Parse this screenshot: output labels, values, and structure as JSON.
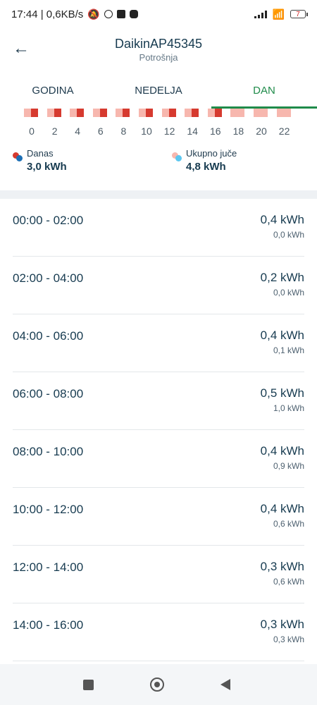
{
  "status": {
    "time_speed": "17:44 | 0,6KB/s",
    "battery": "7"
  },
  "header": {
    "title": "DaikinAP45345",
    "subtitle": "Potrošnja"
  },
  "tabs": [
    {
      "label": "GODINA",
      "active": false
    },
    {
      "label": "NEDELJA",
      "active": false
    },
    {
      "label": "DAN",
      "active": true
    }
  ],
  "chart": {
    "hours": [
      "0",
      "2",
      "4",
      "6",
      "8",
      "10",
      "12",
      "14",
      "16",
      "18",
      "20",
      "22"
    ],
    "today_present": [
      true,
      true,
      true,
      true,
      true,
      true,
      true,
      true,
      true,
      false,
      false,
      false
    ],
    "legend": {
      "today_label": "Danas",
      "today_value": "3,0 kWh",
      "yesterday_label": "Ukupno juče",
      "yesterday_value": "4,8 kWh"
    },
    "colors": {
      "today": "#d63a2f",
      "yesterday": "#f7b7ae",
      "today_dot2": "#1c6fb5",
      "yesterday_dot2": "#5bc7f0"
    }
  },
  "rows": [
    {
      "time": "00:00 - 02:00",
      "value": "0,4 kWh",
      "previous": "0,0 kWh"
    },
    {
      "time": "02:00 - 04:00",
      "value": "0,2 kWh",
      "previous": "0,0 kWh"
    },
    {
      "time": "04:00 - 06:00",
      "value": "0,4 kWh",
      "previous": "0,1 kWh"
    },
    {
      "time": "06:00 - 08:00",
      "value": "0,5 kWh",
      "previous": "1,0 kWh"
    },
    {
      "time": "08:00 - 10:00",
      "value": "0,4 kWh",
      "previous": "0,9 kWh"
    },
    {
      "time": "10:00 - 12:00",
      "value": "0,4 kWh",
      "previous": "0,6 kWh"
    },
    {
      "time": "12:00 - 14:00",
      "value": "0,3 kWh",
      "previous": "0,6 kWh"
    },
    {
      "time": "14:00 - 16:00",
      "value": "0,3 kWh",
      "previous": "0,3 kWh"
    }
  ],
  "accent": "#1f8b4a"
}
